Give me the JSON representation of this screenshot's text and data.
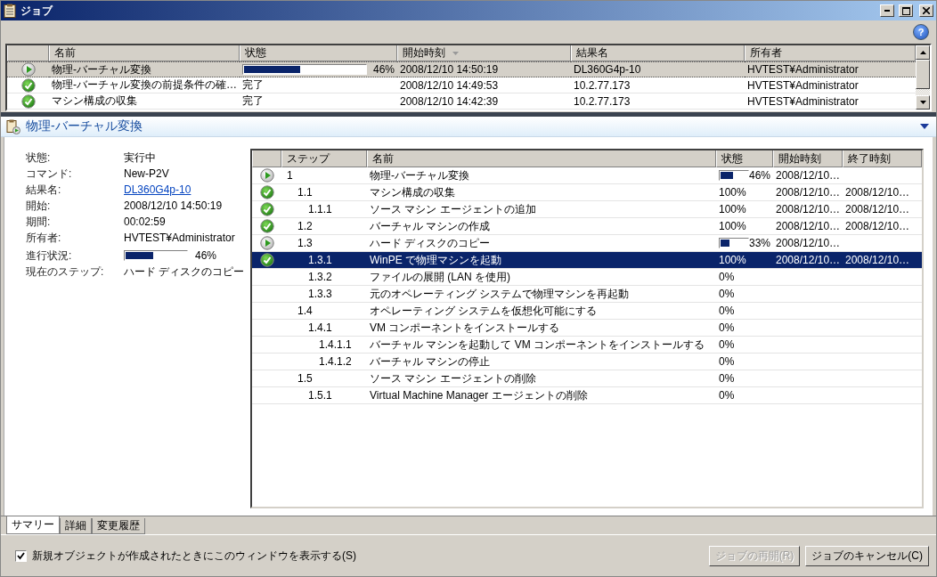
{
  "window": {
    "title": "ジョブ"
  },
  "toolbar": {
    "help_glyph": "?"
  },
  "jobs": {
    "columns": [
      "名前",
      "状態",
      "開始時刻",
      "結果名",
      "所有者"
    ],
    "rows": [
      {
        "kind": "running",
        "name": "物理-バーチャル変換",
        "level": 0.46,
        "reading": "46%",
        "start": "2008/12/10 14:50:19",
        "result": "DL360G4p-10",
        "owner": "HVTEST¥Administrator",
        "selected": true
      },
      {
        "kind": "done",
        "name": "物理-バーチャル変換の前提条件の確…",
        "status": "完了",
        "start": "2008/12/10 14:49:53",
        "result": "10.2.77.173",
        "owner": "HVTEST¥Administrator",
        "selected": false
      },
      {
        "kind": "done",
        "name": "マシン構成の収集",
        "status": "完了",
        "start": "2008/12/10 14:42:39",
        "result": "10.2.77.173",
        "owner": "HVTEST¥Administrator",
        "selected": false
      }
    ]
  },
  "details": {
    "title": "物理-バーチャル変換",
    "properties": [
      {
        "kind": "text",
        "label": "状態:",
        "value": "実行中"
      },
      {
        "kind": "text",
        "label": "コマンド:",
        "value": "New-P2V"
      },
      {
        "kind": "link",
        "label": "結果名:",
        "value": "DL360G4p-10"
      },
      {
        "kind": "text",
        "label": "開始:",
        "value": "2008/12/10 14:50:19"
      },
      {
        "kind": "text",
        "label": "期間:",
        "value": "00:02:59"
      },
      {
        "kind": "text",
        "label": "所有者:",
        "value": "HVTEST¥Administrator"
      },
      {
        "kind": "progress",
        "label": "進行状況:",
        "level": 0.46,
        "value": "46%"
      },
      {
        "kind": "text",
        "label": "現在のステップ:",
        "value": "ハード ディスクのコピー"
      }
    ],
    "steps": {
      "columns": [
        "ステップ",
        "名前",
        "状態",
        "開始時刻",
        "終了時刻"
      ],
      "rows": [
        {
          "kind": "running",
          "step": "1",
          "name": "物理-バーチャル変換",
          "level": 0.46,
          "reading": "46%",
          "start": "2008/12/10…",
          "selected": false,
          "children": [
            {
              "kind": "done",
              "step": "1.1",
              "name": "マシン構成の収集",
              "reading": "100%",
              "start": "2008/12/10…",
              "end": "2008/12/10…",
              "selected": false,
              "children": [
                {
                  "kind": "done",
                  "step": "1.1.1",
                  "name": "ソース マシン エージェントの追加",
                  "reading": "100%",
                  "start": "2008/12/10…",
                  "end": "2008/12/10…",
                  "selected": false
                }
              ]
            },
            {
              "kind": "done",
              "step": "1.2",
              "name": "バーチャル マシンの作成",
              "reading": "100%",
              "start": "2008/12/10…",
              "end": "2008/12/10…",
              "selected": false
            },
            {
              "kind": "running",
              "step": "1.3",
              "name": "ハード ディスクのコピー",
              "level": 0.33,
              "reading": "33%",
              "start": "2008/12/10…",
              "selected": false,
              "children": [
                {
                  "kind": "done",
                  "step": "1.3.1",
                  "name": "WinPE で物理マシンを起動",
                  "reading": "100%",
                  "start": "2008/12/10…",
                  "end": "2008/12/10…",
                  "selected": true
                },
                {
                  "step": "1.3.2",
                  "name": "ファイルの展開 (LAN を使用)",
                  "reading": "0%",
                  "selected": false
                },
                {
                  "step": "1.3.3",
                  "name": "元のオペレーティング システムで物理マシンを再起動",
                  "reading": "0%",
                  "selected": false
                }
              ]
            },
            {
              "step": "1.4",
              "name": "オペレーティング システムを仮想化可能にする",
              "reading": "0%",
              "selected": false,
              "children": [
                {
                  "step": "1.4.1",
                  "name": "VM コンポーネントをインストールする",
                  "reading": "0%",
                  "selected": false,
                  "children": [
                    {
                      "step": "1.4.1.1",
                      "name": "バーチャル マシンを起動して VM コンポーネントをインストールする",
                      "reading": "0%",
                      "selected": false
                    },
                    {
                      "step": "1.4.1.2",
                      "name": "バーチャル マシンの停止",
                      "reading": "0%",
                      "selected": false
                    }
                  ]
                }
              ]
            },
            {
              "step": "1.5",
              "name": "ソース マシン エージェントの削除",
              "reading": "0%",
              "selected": false,
              "children": [
                {
                  "step": "1.5.1",
                  "name": "Virtual Machine Manager エージェントの削除",
                  "reading": "0%",
                  "selected": false
                }
              ]
            }
          ]
        }
      ]
    }
  },
  "tabs": [
    {
      "label": "サマリー",
      "selected": true
    },
    {
      "label": "詳細",
      "selected": false
    },
    {
      "label": "変更履歴",
      "selected": false
    }
  ],
  "footer": {
    "checkbox": {
      "label": "新規オブジェクトが作成されたときにこのウィンドウを表示する(S)",
      "checked": true
    },
    "buttons": [
      {
        "label": "ジョブの再開(R)",
        "disabled": true
      },
      {
        "label": "ジョブのキャンセル(C)",
        "disabled": false
      }
    ]
  }
}
